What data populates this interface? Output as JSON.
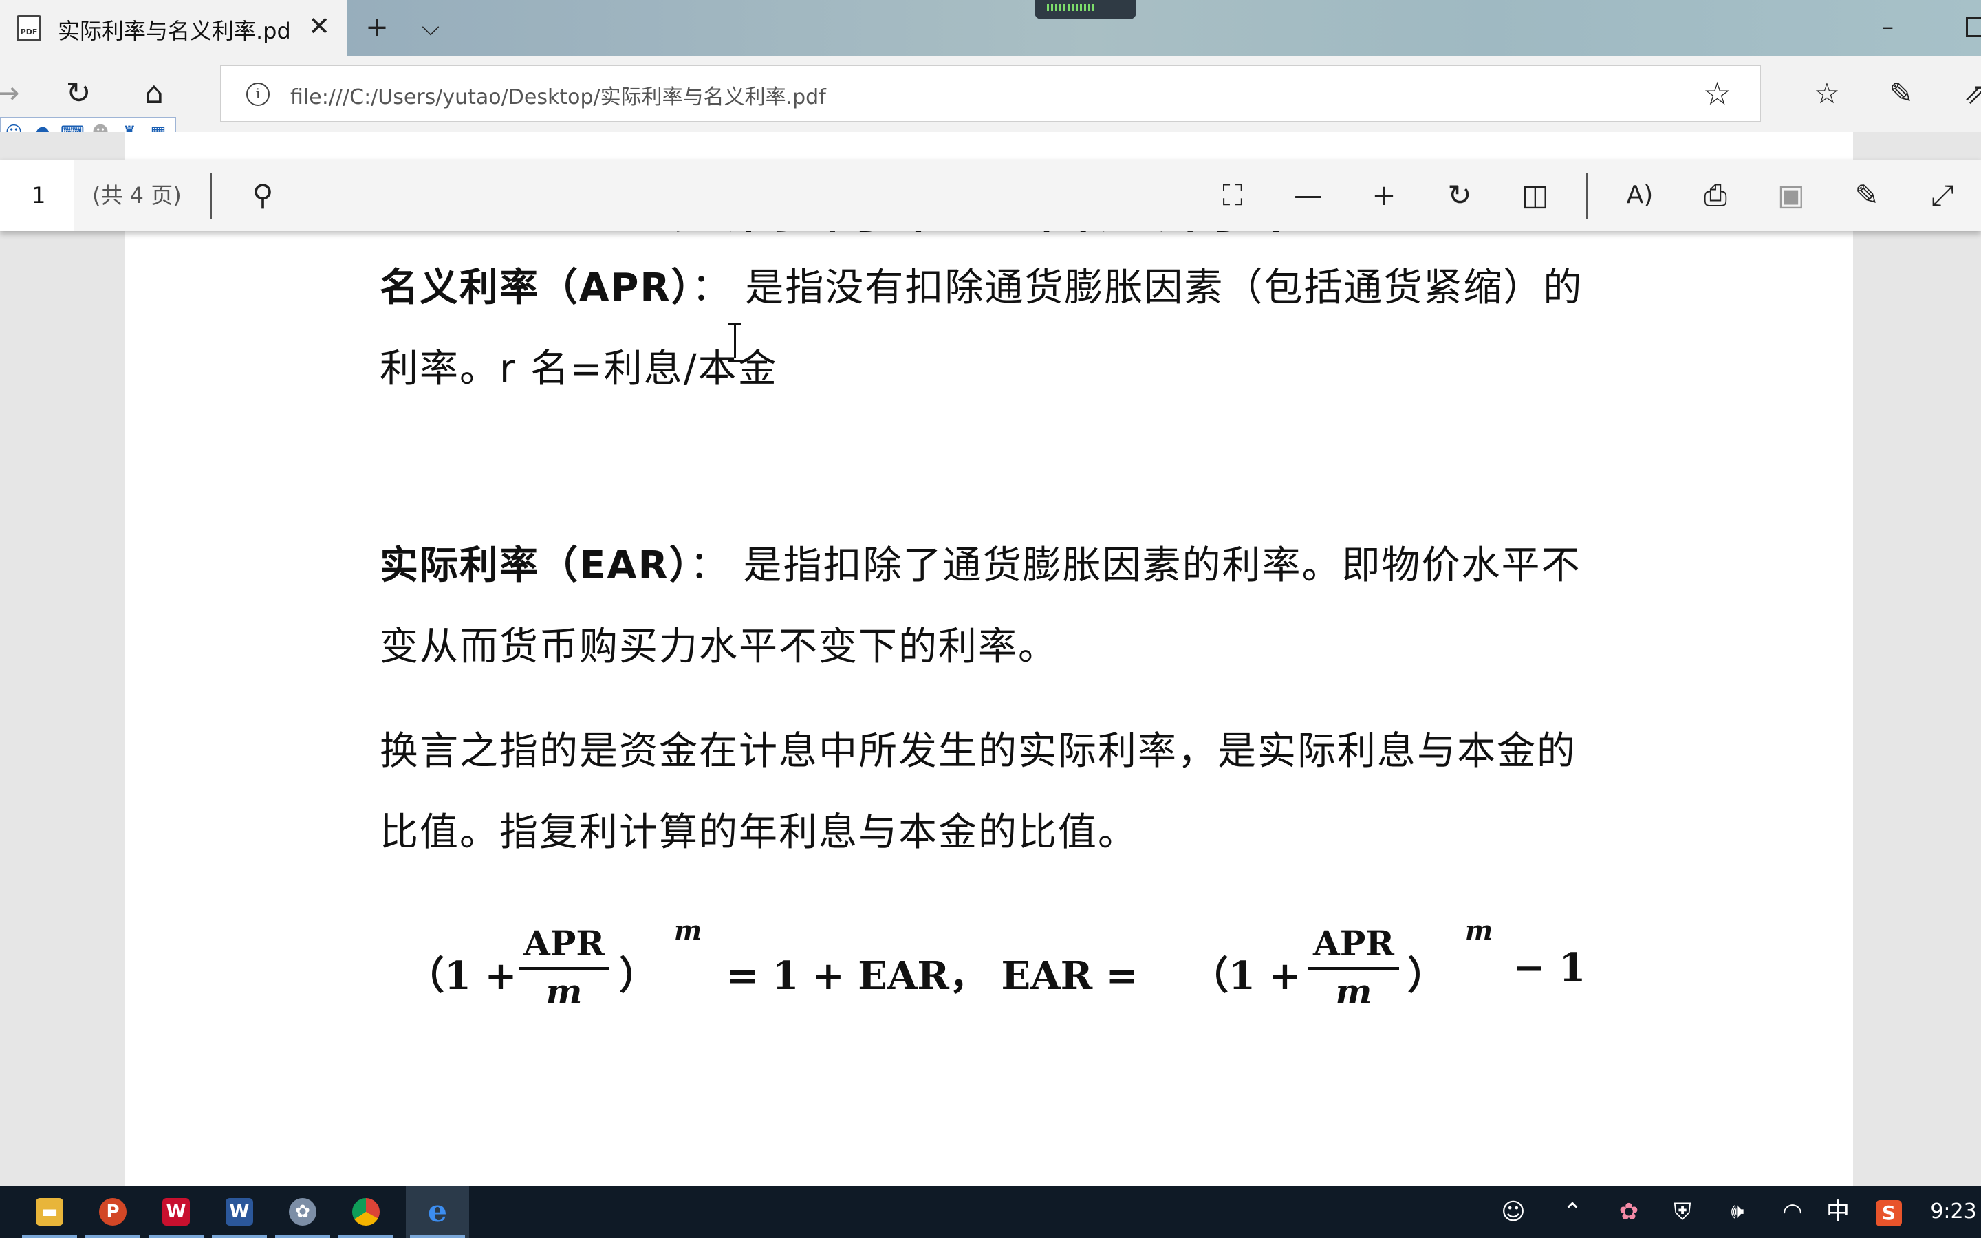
{
  "browser": {
    "tab": {
      "title": "实际利率与名义利率.pd",
      "icon": "pdf-icon",
      "close_glyph": "✕"
    },
    "new_tab_glyph": "+",
    "tab_list_glyph": "⌵",
    "address": {
      "url": "file:///C:/Users/yutao/Desktop/实际利率与名义利率.pdf",
      "info_glyph": "i"
    }
  },
  "pdf_toolbar": {
    "page_number": "1",
    "page_count": "(共 4 页)"
  },
  "document": {
    "title": "实际利率与名义利率",
    "apr": {
      "term": "名义利率（APR）",
      "separator": "：",
      "definition": "是指没有扣除通货膨胀因素（包括通货紧缩）的利率。r 名=利息/本金"
    },
    "ear": {
      "term": "实际利率（EAR）",
      "separator": "：",
      "definition": "是指扣除了通货膨胀因素的利率。即物价水平不变从而货币购买力水平不变下的利率。"
    },
    "note": "换言之指的是资金在计息中所发生的实际利率，是实际利息与本金的比值。指复利计算的年利息与本金的比值。",
    "formula": {
      "left_paren_open": "（1 +",
      "frac_num": "APR",
      "frac_den": "m",
      "paren_close": "）",
      "exponent": "m",
      "eq1": "= 1 + EAR，  EAR =",
      "right_paren_open": "（1 +",
      "tail": "− 1"
    }
  },
  "taskbar": {
    "ime_mode": "中",
    "clock": "9:23"
  },
  "colors": {
    "tab_active_bg": "#f2f2f2",
    "taskbar_bg": "#0f1a26",
    "edge_blue": "#1a73e8"
  }
}
